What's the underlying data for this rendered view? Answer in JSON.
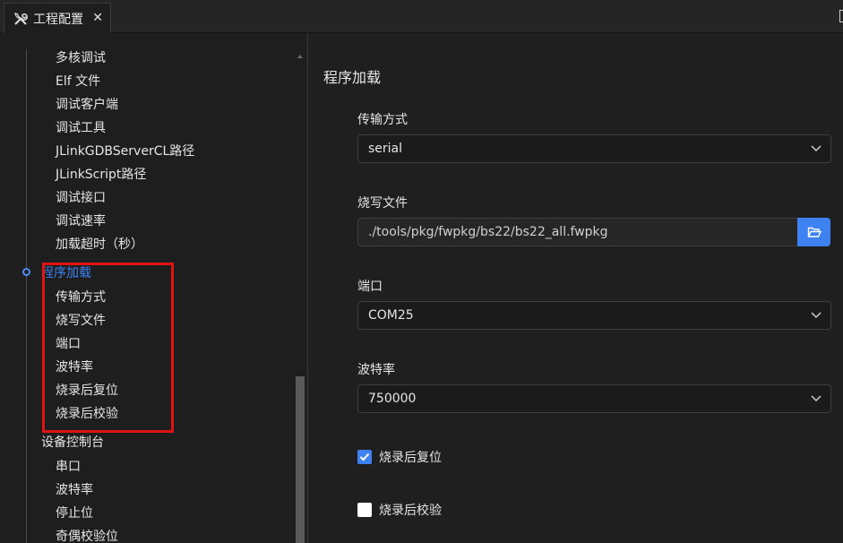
{
  "tab": {
    "label": "工程配置",
    "close": "✕"
  },
  "tree": {
    "items": [
      {
        "label": "多核调试"
      },
      {
        "label": "Elf 文件"
      },
      {
        "label": "调试客户端"
      },
      {
        "label": "调试工具"
      },
      {
        "label": "JLinkGDBServerCL路径"
      },
      {
        "label": "JLinkScript路径"
      },
      {
        "label": "调试接口"
      },
      {
        "label": "调试速率"
      },
      {
        "label": "加载超时（秒）"
      },
      {
        "label": "程序加载"
      },
      {
        "label": "传输方式"
      },
      {
        "label": "烧写文件"
      },
      {
        "label": "端口"
      },
      {
        "label": "波特率"
      },
      {
        "label": "烧录后复位"
      },
      {
        "label": "烧录后校验"
      },
      {
        "label": "设备控制台"
      },
      {
        "label": "串口"
      },
      {
        "label": "波特率"
      },
      {
        "label": "停止位"
      },
      {
        "label": "奇偶校验位"
      }
    ]
  },
  "main": {
    "section_title": "程序加载",
    "transfer": {
      "label": "传输方式",
      "value": "serial"
    },
    "burn_file": {
      "label": "烧写文件",
      "value": "./tools/pkg/fwpkg/bs22/bs22_all.fwpkg"
    },
    "port": {
      "label": "端口",
      "value": "COM25"
    },
    "baud": {
      "label": "波特率",
      "value": "750000"
    },
    "reset_after": {
      "label": "烧录后复位",
      "checked": true
    },
    "verify_after": {
      "label": "烧录后校验",
      "checked": false
    }
  },
  "colors": {
    "accent": "#3d82f0",
    "highlight": "#e01313",
    "active_text": "#3b82f6"
  }
}
